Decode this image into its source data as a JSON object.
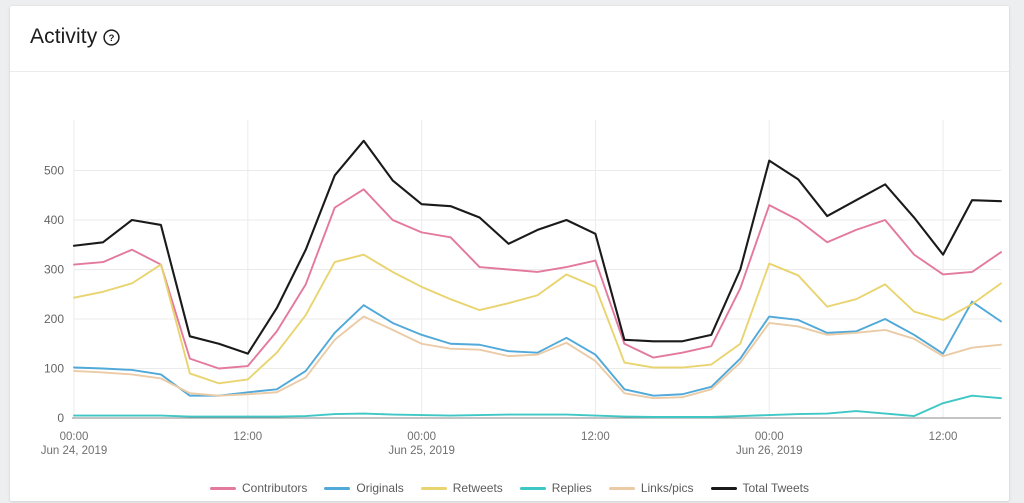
{
  "card": {
    "title": "Activity",
    "help_icon": "question-mark-circle-icon"
  },
  "chart_data": {
    "type": "line",
    "title": "Activity",
    "xlabel": "",
    "ylabel": "",
    "ylim": [
      0,
      560
    ],
    "yticks": [
      0,
      100,
      200,
      300,
      400,
      500
    ],
    "ytick_labels": [
      "0",
      "100",
      "200",
      "300",
      "400",
      "500"
    ],
    "grid": true,
    "legend_position": "bottom",
    "x_axis_ticks": [
      {
        "time": "00:00",
        "date": "Jun 24, 2019",
        "index": 0
      },
      {
        "time": "12:00",
        "date": "",
        "index": 6
      },
      {
        "time": "00:00",
        "date": "Jun 25, 2019",
        "index": 12
      },
      {
        "time": "12:00",
        "date": "",
        "index": 18
      },
      {
        "time": "00:00",
        "date": "Jun 26, 2019",
        "index": 24
      },
      {
        "time": "12:00",
        "date": "",
        "index": 30
      }
    ],
    "x": [
      "00:00 Jun 24",
      "02:00 Jun 24",
      "04:00 Jun 24",
      "06:00 Jun 24",
      "08:00 Jun 24",
      "10:00 Jun 24",
      "12:00 Jun 24",
      "14:00 Jun 24",
      "16:00 Jun 24",
      "18:00 Jun 24",
      "20:00 Jun 24",
      "22:00 Jun 24",
      "00:00 Jun 25",
      "02:00 Jun 25",
      "04:00 Jun 25",
      "06:00 Jun 25",
      "08:00 Jun 25",
      "10:00 Jun 25",
      "12:00 Jun 25",
      "14:00 Jun 25",
      "16:00 Jun 25",
      "18:00 Jun 25",
      "20:00 Jun 25",
      "22:00 Jun 25",
      "00:00 Jun 26",
      "02:00 Jun 26",
      "04:00 Jun 26",
      "06:00 Jun 26",
      "08:00 Jun 26",
      "10:00 Jun 26",
      "12:00 Jun 26",
      "14:00 Jun 26",
      "16:00 Jun 26"
    ],
    "series": [
      {
        "name": "Contributors",
        "color": "#e3799d",
        "values": [
          310,
          315,
          340,
          310,
          120,
          100,
          105,
          175,
          270,
          425,
          462,
          400,
          375,
          365,
          305,
          300,
          295,
          305,
          318,
          150,
          122,
          132,
          145,
          262,
          430,
          400,
          355,
          380,
          400,
          330,
          290,
          295,
          335
        ]
      },
      {
        "name": "Originals",
        "color": "#50a9d9",
        "values": [
          102,
          100,
          97,
          88,
          45,
          45,
          52,
          58,
          95,
          172,
          228,
          192,
          168,
          150,
          148,
          135,
          132,
          162,
          128,
          58,
          45,
          48,
          63,
          120,
          205,
          198,
          172,
          175,
          200,
          168,
          130,
          235,
          195
        ]
      },
      {
        "name": "Retweets",
        "color": "#e9d470",
        "values": [
          243,
          255,
          272,
          310,
          90,
          70,
          78,
          132,
          208,
          315,
          330,
          295,
          265,
          240,
          218,
          232,
          248,
          290,
          265,
          112,
          102,
          102,
          108,
          150,
          312,
          288,
          225,
          240,
          270,
          215,
          198,
          230,
          272
        ]
      },
      {
        "name": "Replies",
        "color": "#3fc7c5",
        "values": [
          5,
          5,
          5,
          5,
          3,
          3,
          3,
          3,
          4,
          8,
          9,
          7,
          6,
          5,
          6,
          7,
          7,
          7,
          5,
          3,
          2,
          2,
          2,
          4,
          6,
          8,
          9,
          14,
          9,
          4,
          30,
          45,
          40
        ]
      },
      {
        "name": "Links/pics",
        "color": "#ebcba6",
        "values": [
          95,
          92,
          88,
          80,
          50,
          45,
          48,
          52,
          82,
          158,
          205,
          178,
          150,
          140,
          138,
          125,
          128,
          152,
          115,
          50,
          40,
          42,
          58,
          112,
          192,
          185,
          168,
          172,
          178,
          160,
          125,
          142,
          148
        ]
      },
      {
        "name": "Total Tweets",
        "color": "#1a1a1a",
        "values": [
          348,
          355,
          400,
          390,
          165,
          150,
          130,
          222,
          340,
          490,
          560,
          480,
          432,
          428,
          405,
          352,
          380,
          400,
          372,
          158,
          155,
          155,
          168,
          300,
          520,
          482,
          408,
          440,
          472,
          405,
          330,
          440,
          438
        ]
      }
    ],
    "series_second_half": {
      "note": "continuation"
    }
  },
  "legend": {
    "items": [
      {
        "label": "Contributors",
        "color": "#e3799d"
      },
      {
        "label": "Originals",
        "color": "#50a9d9"
      },
      {
        "label": "Retweets",
        "color": "#e9d470"
      },
      {
        "label": "Replies",
        "color": "#3fc7c5"
      },
      {
        "label": "Links/pics",
        "color": "#ebcba6"
      },
      {
        "label": "Total Tweets",
        "color": "#1a1a1a"
      }
    ]
  },
  "colors": {
    "page_background": "#eceef0",
    "card_background": "#ffffff",
    "grid": "#ebebeb",
    "axis": "#8a8a8a",
    "text": "#5c5c5c",
    "title": "#1c1c1c"
  }
}
